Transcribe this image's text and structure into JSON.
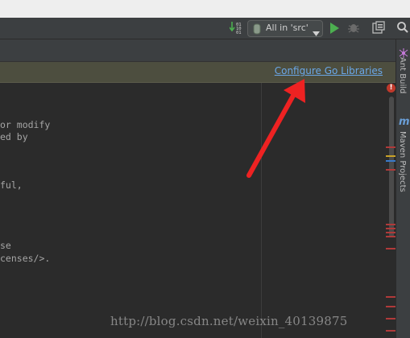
{
  "toolbar": {
    "run_config_label": "All in 'src'",
    "icons": [
      "sort-icon",
      "run-config-icon",
      "dropdown-caret-icon",
      "run-icon",
      "debug-icon",
      "build-icon",
      "search-icon"
    ]
  },
  "banner": {
    "link_text": "Configure Go Libraries",
    "link_color": "#6aa7e8",
    "background": "#4d4e3f"
  },
  "editor": {
    "lines": [
      "or modify",
      "ed by",
      "ful,",
      "se",
      "censes/>."
    ]
  },
  "right_panel": {
    "tabs": [
      {
        "label": "Ant Build",
        "icon": "ant-icon"
      },
      {
        "label": "Maven Projects",
        "icon": "maven-icon",
        "icon_text": "m"
      }
    ]
  },
  "status": {
    "error_indicator": "!"
  },
  "watermark": {
    "text": "http://blog.csdn.net/weixin_40139875"
  },
  "annotation": {
    "arrow_color": "#ee2222"
  }
}
